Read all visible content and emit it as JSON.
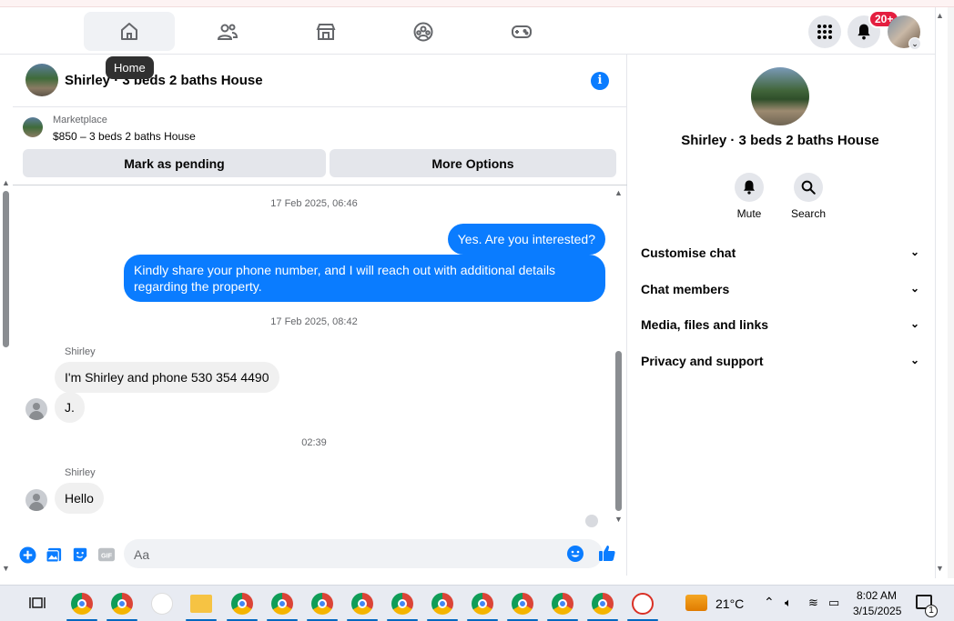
{
  "nav": {
    "tabs": [
      {
        "name": "home",
        "icon": "home-icon",
        "active": true
      },
      {
        "name": "friends",
        "icon": "friends-icon",
        "active": false
      },
      {
        "name": "marketplace",
        "icon": "marketplace-icon",
        "active": false
      },
      {
        "name": "groups",
        "icon": "groups-icon",
        "active": false
      },
      {
        "name": "gaming",
        "icon": "gaming-icon",
        "active": false
      }
    ],
    "tooltip": "Home",
    "notification_badge": "20+"
  },
  "chat": {
    "title": "Shirley · 3 beds 2 baths House",
    "marketplace_label": "Marketplace",
    "listing": "$850 – 3 beds 2 baths House",
    "btn_pending": "Mark as pending",
    "btn_more": "More Options",
    "messages": {
      "ts1": "17 Feb 2025, 06:46",
      "out1": "Yes. Are you interested?",
      "out2": "Kindly share your phone number, and I will reach out with additional details regarding the property.",
      "ts2": "17 Feb 2025, 08:42",
      "sender1": "Shirley",
      "in1": "I'm Shirley and phone 530 354 4490",
      "in2": "J.",
      "ts3": "02:39",
      "sender2": "Shirley",
      "in3": "Hello"
    },
    "composer_placeholder": "Aa"
  },
  "profile": {
    "name": "Shirley · 3 beds 2 baths House",
    "actions": [
      {
        "label": "Mute",
        "icon": "bell-icon"
      },
      {
        "label": "Search",
        "icon": "search-icon"
      }
    ],
    "sections": [
      "Customise chat",
      "Chat members",
      "Media, files and links",
      "Privacy and support"
    ]
  },
  "taskbar": {
    "weather": "21°C",
    "time": "8:02 AM",
    "date": "3/15/2025",
    "notif_count": "1"
  },
  "colors": {
    "accent": "#0a7cff",
    "badge": "#e41e3f"
  }
}
